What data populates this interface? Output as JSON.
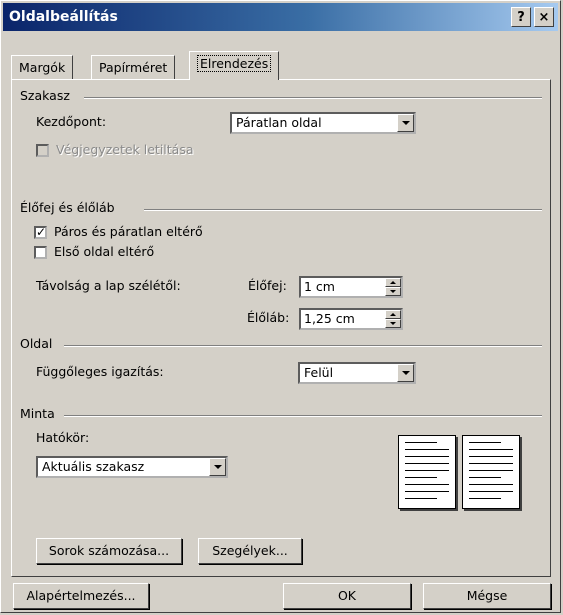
{
  "window": {
    "title": "Oldalbeállítás",
    "help_btn": "?",
    "close_btn": "×"
  },
  "tabs": [
    {
      "label": "Margók",
      "active": false
    },
    {
      "label": "Papírméret",
      "active": false
    },
    {
      "label": "Elrendezés",
      "active": true
    }
  ],
  "section_szakasz": {
    "heading": "Szakasz",
    "start_label": "Kezdőpont:",
    "start_value": "Páratlan oldal",
    "endnotes_label": "Végjegyzetek letiltása",
    "endnotes_checked": false
  },
  "section_header": {
    "heading": "Élőfej és élőláb",
    "odd_even_label": "Páros és páratlan eltérő",
    "odd_even_checked": true,
    "odd_even_mark": "✓",
    "first_page_label": "Első oldal eltérő",
    "first_page_checked": false,
    "distance_label": "Távolság a lap szélétől:",
    "header_label": "Élőfej:",
    "header_value": "1 cm",
    "footer_label": "Élőláb:",
    "footer_value": "1,25 cm"
  },
  "section_page": {
    "heading": "Oldal",
    "valign_label": "Függőleges igazítás:",
    "valign_value": "Felül"
  },
  "section_preview": {
    "heading": "Minta",
    "scope_label": "Hatókör:",
    "scope_value": "Aktuális szakasz"
  },
  "buttons": {
    "line_numbers": "Sorok számozása...",
    "borders": "Szegélyek...",
    "default": "Alapértelmezés...",
    "ok": "OK",
    "cancel": "Mégse"
  }
}
